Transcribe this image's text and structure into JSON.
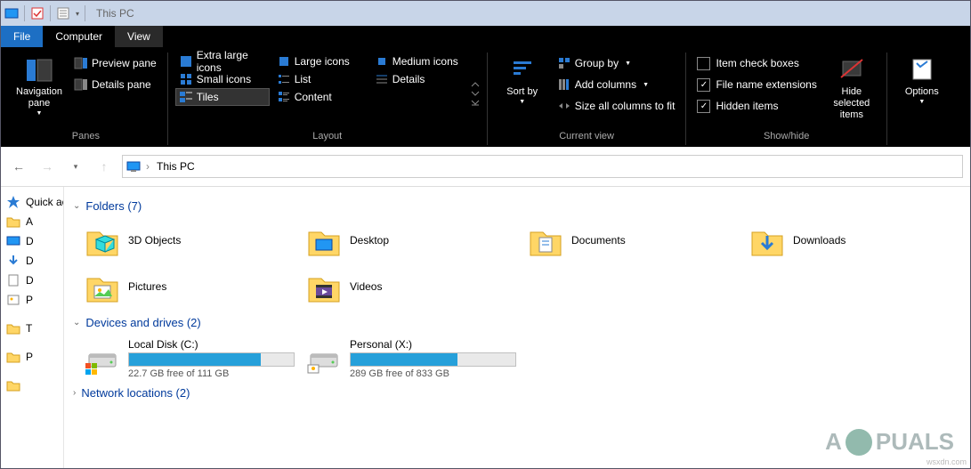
{
  "titlebar": {
    "title": "This PC"
  },
  "tabs": {
    "file": "File",
    "computer": "Computer",
    "view": "View"
  },
  "ribbon": {
    "panes": {
      "nav": "Navigation pane",
      "preview": "Preview pane",
      "details": "Details pane",
      "group": "Panes"
    },
    "layout": {
      "xl": "Extra large icons",
      "large": "Large icons",
      "medium": "Medium icons",
      "small": "Small icons",
      "list": "List",
      "details": "Details",
      "tiles": "Tiles",
      "content": "Content",
      "group": "Layout"
    },
    "current": {
      "sort": "Sort by",
      "groupby": "Group by",
      "addcols": "Add columns",
      "sizecols": "Size all columns to fit",
      "group": "Current view"
    },
    "show": {
      "checkboxes": "Item check boxes",
      "exts": "File name extensions",
      "hidden": "Hidden items",
      "hidesel": "Hide selected items",
      "group": "Show/hide"
    },
    "options": "Options"
  },
  "address": {
    "root": "This PC"
  },
  "sidebar": {
    "quick": "Quick access",
    "s1": "A",
    "s2": "D",
    "s3": "D",
    "s4": "D",
    "s5": "P",
    "s6": "T",
    "s7": "P"
  },
  "sections": {
    "folders": "Folders (7)",
    "drives": "Devices and drives (2)",
    "network": "Network locations (2)"
  },
  "folders": [
    {
      "name": "3D Objects"
    },
    {
      "name": "Desktop"
    },
    {
      "name": "Documents"
    },
    {
      "name": "Downloads"
    },
    {
      "name": "Pictures"
    },
    {
      "name": "Videos"
    }
  ],
  "drives": [
    {
      "name": "Local Disk (C:)",
      "free": "22.7 GB free of 111 GB",
      "fillPct": 80
    },
    {
      "name": "Personal (X:)",
      "free": "289 GB free of 833 GB",
      "fillPct": 65
    }
  ],
  "watermark": {
    "text_a": "A",
    "text_b": "PUALS"
  },
  "attrib": "wsxdn.com"
}
